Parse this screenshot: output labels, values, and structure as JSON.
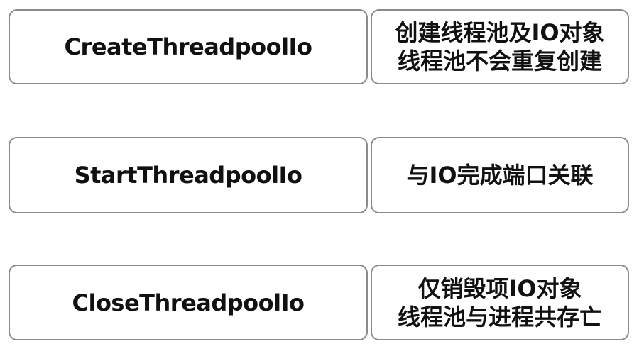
{
  "rows": [
    {
      "function": "CreateThreadpoolIo",
      "description": [
        "创建线程池及IO对象",
        "线程池不会重复创建"
      ]
    },
    {
      "function": "StartThreadpoolIo",
      "description": [
        "与IO完成端口关联"
      ]
    },
    {
      "function": "CloseThreadpoolIo",
      "description": [
        "仅销毁项IO对象",
        "线程池与进程共存亡"
      ]
    }
  ]
}
